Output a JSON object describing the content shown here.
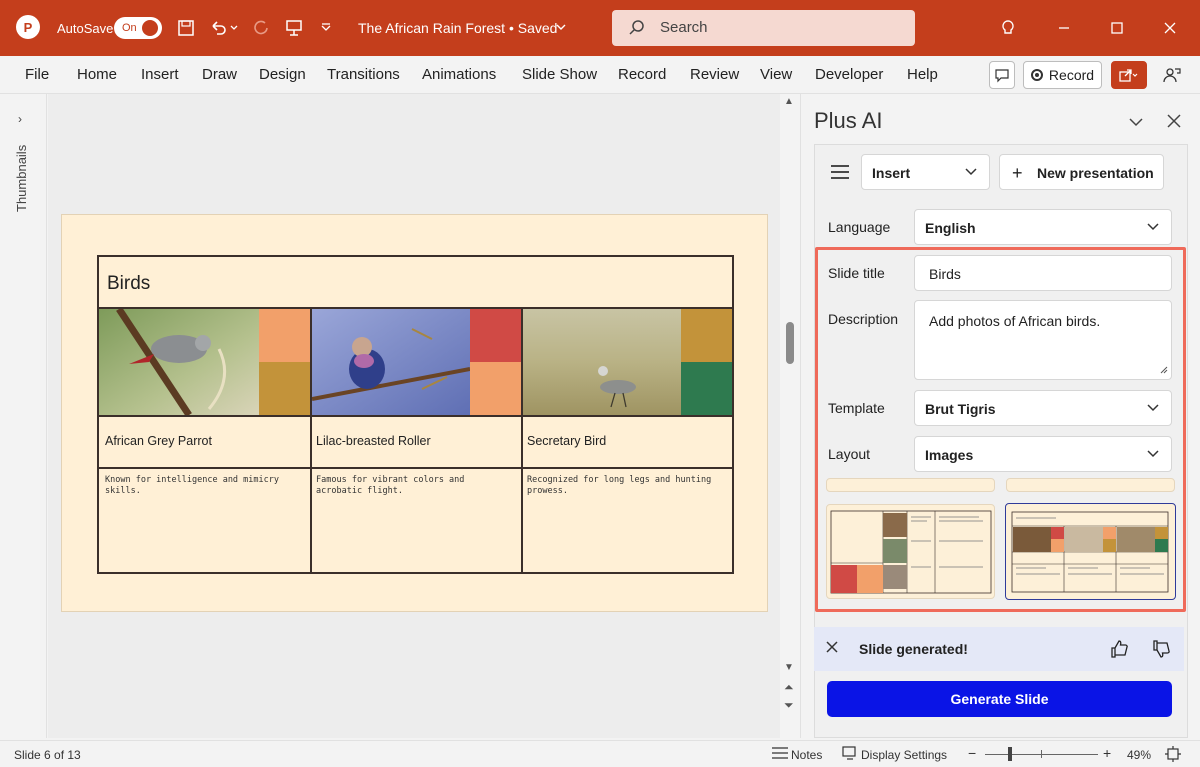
{
  "titlebar": {
    "app_logo": "P",
    "autosave_label": "AutoSave",
    "autosave_state": "On",
    "doc_title": "The African Rain Forest • Saved",
    "search_placeholder": "Search"
  },
  "menubar": {
    "items": [
      "File",
      "Home",
      "Insert",
      "Draw",
      "Design",
      "Transitions",
      "Animations",
      "Slide Show",
      "Record",
      "Review",
      "View",
      "Developer",
      "Help"
    ],
    "record_label": "Record"
  },
  "thumbnails": {
    "label": "Thumbnails"
  },
  "slide": {
    "title": "Birds",
    "items": [
      {
        "name": "African Grey Parrot",
        "desc": "Known for intelligence and mimicry skills."
      },
      {
        "name": "Lilac-breasted Roller",
        "desc": "Famous for vibrant colors and acrobatic flight."
      },
      {
        "name": "Secretary Bird",
        "desc": "Recognized for long legs and hunting prowess."
      }
    ],
    "swatch_colors": [
      "#f2a06a",
      "#c3933a",
      "#d04a45",
      "#f2a06a",
      "#c3933a",
      "#2e7a4f"
    ]
  },
  "pane": {
    "title": "Plus AI",
    "insert_dropdown": "Insert",
    "new_presentation": "New presentation",
    "language_label": "Language",
    "language_value": "English",
    "slide_title_label": "Slide title",
    "slide_title_value": "Birds",
    "description_label": "Description",
    "description_value": "Add photos of African birds.",
    "template_label": "Template",
    "template_value": "Brut Tigris",
    "layout_label": "Layout",
    "layout_value": "Images",
    "generated_msg": "Slide generated!",
    "generate_button": "Generate Slide"
  },
  "statusbar": {
    "slide_info": "Slide 6 of 13",
    "notes": "Notes",
    "display_settings": "Display Settings",
    "zoom": "49%"
  },
  "colors": {
    "accent": "#c43e1c",
    "primary_button": "#0a14e6",
    "highlight_box": "#ef6a5a"
  }
}
